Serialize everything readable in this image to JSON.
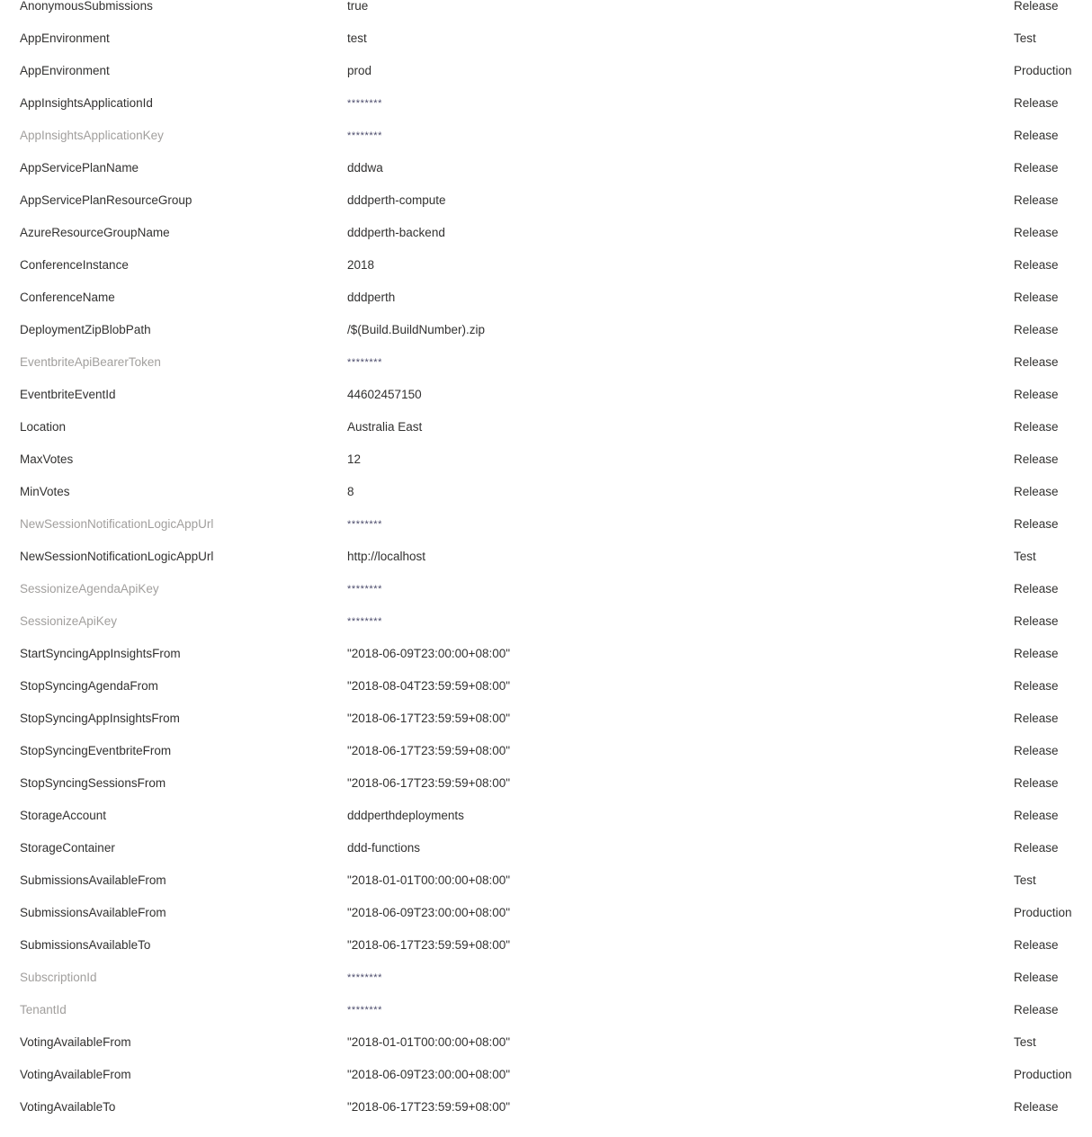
{
  "list": {
    "masked_value_text": "********",
    "rows": [
      {
        "name": "AnonymousSubmissions",
        "value": "true",
        "scope": "Release",
        "secret": false
      },
      {
        "name": "AppEnvironment",
        "value": "test",
        "scope": "Test",
        "secret": false
      },
      {
        "name": "AppEnvironment",
        "value": "prod",
        "scope": "Production",
        "secret": false
      },
      {
        "name": "AppInsightsApplicationId",
        "value": "********",
        "scope": "Release",
        "secret": false,
        "masked": true
      },
      {
        "name": "AppInsightsApplicationKey",
        "value": "********",
        "scope": "Release",
        "secret": true,
        "masked": true
      },
      {
        "name": "AppServicePlanName",
        "value": "dddwa",
        "scope": "Release",
        "secret": false
      },
      {
        "name": "AppServicePlanResourceGroup",
        "value": "dddperth-compute",
        "scope": "Release",
        "secret": false
      },
      {
        "name": "AzureResourceGroupName",
        "value": "dddperth-backend",
        "scope": "Release",
        "secret": false
      },
      {
        "name": "ConferenceInstance",
        "value": "2018",
        "scope": "Release",
        "secret": false
      },
      {
        "name": "ConferenceName",
        "value": "dddperth",
        "scope": "Release",
        "secret": false
      },
      {
        "name": "DeploymentZipBlobPath",
        "value": "/$(Build.BuildNumber).zip",
        "scope": "Release",
        "secret": false
      },
      {
        "name": "EventbriteApiBearerToken",
        "value": "********",
        "scope": "Release",
        "secret": true,
        "masked": true
      },
      {
        "name": "EventbriteEventId",
        "value": "44602457150",
        "scope": "Release",
        "secret": false
      },
      {
        "name": "Location",
        "value": "Australia East",
        "scope": "Release",
        "secret": false
      },
      {
        "name": "MaxVotes",
        "value": "12",
        "scope": "Release",
        "secret": false
      },
      {
        "name": "MinVotes",
        "value": "8",
        "scope": "Release",
        "secret": false
      },
      {
        "name": "NewSessionNotificationLogicAppUrl",
        "value": "********",
        "scope": "Release",
        "secret": true,
        "masked": true
      },
      {
        "name": "NewSessionNotificationLogicAppUrl",
        "value": "http://localhost",
        "scope": "Test",
        "secret": false
      },
      {
        "name": "SessionizeAgendaApiKey",
        "value": "********",
        "scope": "Release",
        "secret": true,
        "masked": true
      },
      {
        "name": "SessionizeApiKey",
        "value": "********",
        "scope": "Release",
        "secret": true,
        "masked": true
      },
      {
        "name": "StartSyncingAppInsightsFrom",
        "value": "\"2018-06-09T23:00:00+08:00\"",
        "scope": "Release",
        "secret": false
      },
      {
        "name": "StopSyncingAgendaFrom",
        "value": "\"2018-08-04T23:59:59+08:00\"",
        "scope": "Release",
        "secret": false
      },
      {
        "name": "StopSyncingAppInsightsFrom",
        "value": "\"2018-06-17T23:59:59+08:00\"",
        "scope": "Release",
        "secret": false
      },
      {
        "name": "StopSyncingEventbriteFrom",
        "value": "\"2018-06-17T23:59:59+08:00\"",
        "scope": "Release",
        "secret": false
      },
      {
        "name": "StopSyncingSessionsFrom",
        "value": "\"2018-06-17T23:59:59+08:00\"",
        "scope": "Release",
        "secret": false
      },
      {
        "name": "StorageAccount",
        "value": "dddperthdeployments",
        "scope": "Release",
        "secret": false
      },
      {
        "name": "StorageContainer",
        "value": "ddd-functions",
        "scope": "Release",
        "secret": false
      },
      {
        "name": "SubmissionsAvailableFrom",
        "value": "\"2018-01-01T00:00:00+08:00\"",
        "scope": "Test",
        "secret": false
      },
      {
        "name": "SubmissionsAvailableFrom",
        "value": "\"2018-06-09T23:00:00+08:00\"",
        "scope": "Production",
        "secret": false
      },
      {
        "name": "SubmissionsAvailableTo",
        "value": "\"2018-06-17T23:59:59+08:00\"",
        "scope": "Release",
        "secret": false
      },
      {
        "name": "SubscriptionId",
        "value": "********",
        "scope": "Release",
        "secret": true,
        "masked": true
      },
      {
        "name": "TenantId",
        "value": "********",
        "scope": "Release",
        "secret": true,
        "masked": true
      },
      {
        "name": "VotingAvailableFrom",
        "value": "\"2018-01-01T00:00:00+08:00\"",
        "scope": "Test",
        "secret": false
      },
      {
        "name": "VotingAvailableFrom",
        "value": "\"2018-06-09T23:00:00+08:00\"",
        "scope": "Production",
        "secret": false
      },
      {
        "name": "VotingAvailableTo",
        "value": "\"2018-06-17T23:59:59+08:00\"",
        "scope": "Release",
        "secret": false
      }
    ]
  }
}
